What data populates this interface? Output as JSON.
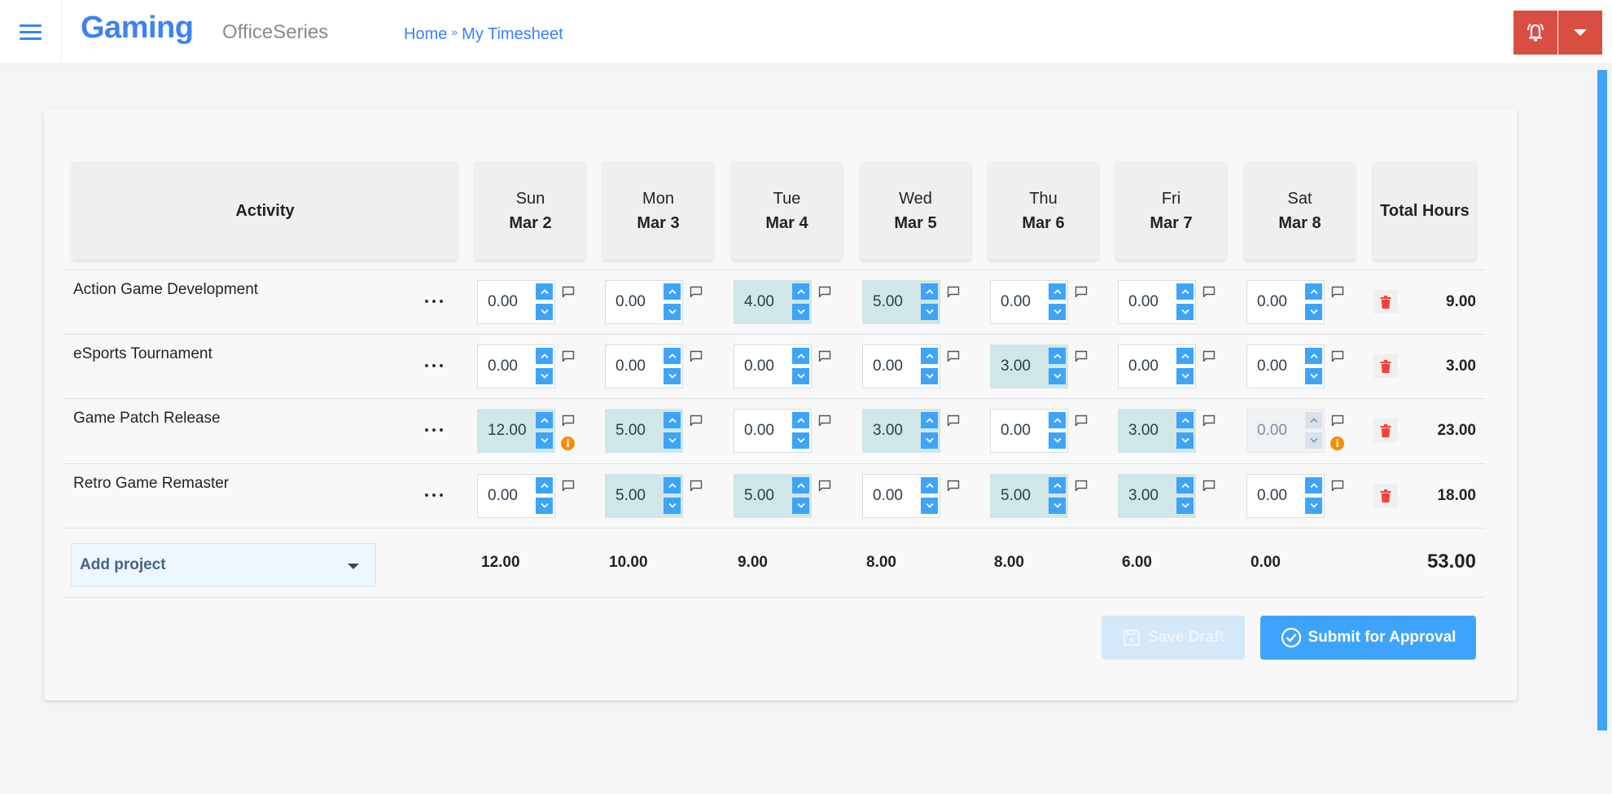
{
  "header": {
    "brand": "Gaming",
    "subbrand": "OfficeSeries",
    "breadcrumb": [
      {
        "label": "Home"
      },
      {
        "label": "My Timesheet"
      }
    ],
    "breadcrumb_separator": "»",
    "icons": {
      "menu": "hamburger-icon",
      "notifications": "bell-ring-icon",
      "dropdown": "caret-down-icon"
    },
    "accent_color": "#3b82f6",
    "action_color": "#d84f42"
  },
  "timesheet": {
    "columns": {
      "activity": "Activity",
      "total": "Total Hours",
      "days": [
        {
          "day": "Sun",
          "date": "Mar 2"
        },
        {
          "day": "Mon",
          "date": "Mar 3"
        },
        {
          "day": "Tue",
          "date": "Mar 4"
        },
        {
          "day": "Wed",
          "date": "Mar 5"
        },
        {
          "day": "Thu",
          "date": "Mar 6"
        },
        {
          "day": "Fri",
          "date": "Mar 7"
        },
        {
          "day": "Sat",
          "date": "Mar 8"
        }
      ]
    },
    "rows": [
      {
        "activity": "Action Game Development",
        "hours": [
          "0.00",
          "0.00",
          "4.00",
          "5.00",
          "0.00",
          "0.00",
          "0.00"
        ],
        "info": [
          false,
          false,
          false,
          false,
          false,
          false,
          false
        ],
        "disabled": [
          false,
          false,
          false,
          false,
          false,
          false,
          false
        ],
        "total": "9.00"
      },
      {
        "activity": "eSports Tournament",
        "hours": [
          "0.00",
          "0.00",
          "0.00",
          "0.00",
          "3.00",
          "0.00",
          "0.00"
        ],
        "info": [
          false,
          false,
          false,
          false,
          false,
          false,
          false
        ],
        "disabled": [
          false,
          false,
          false,
          false,
          false,
          false,
          false
        ],
        "total": "3.00"
      },
      {
        "activity": "Game Patch Release",
        "hours": [
          "12.00",
          "5.00",
          "0.00",
          "3.00",
          "0.00",
          "3.00",
          "0.00"
        ],
        "info": [
          true,
          false,
          false,
          false,
          false,
          false,
          true
        ],
        "disabled": [
          false,
          false,
          false,
          false,
          false,
          false,
          true
        ],
        "total": "23.00"
      },
      {
        "activity": "Retro Game Remaster",
        "hours": [
          "0.00",
          "5.00",
          "5.00",
          "0.00",
          "5.00",
          "3.00",
          "0.00"
        ],
        "info": [
          false,
          false,
          false,
          false,
          false,
          false,
          false
        ],
        "disabled": [
          false,
          false,
          false,
          false,
          false,
          false,
          false
        ],
        "total": "18.00"
      }
    ],
    "info_badge_glyph": "i",
    "add_project": {
      "label": "Add project"
    },
    "day_totals": [
      "12.00",
      "10.00",
      "9.00",
      "8.00",
      "8.00",
      "6.00",
      "0.00"
    ],
    "grand_total": "53.00",
    "filled_cell_color": "#d1e6e6",
    "info_color": "#fb8c00",
    "delete_color": "#f44336"
  },
  "actions": {
    "save_draft": {
      "label": "Save Draft",
      "icon": "floppy-disk-icon",
      "disabled": true
    },
    "submit": {
      "label": "Submit for Approval",
      "icon": "check-circle-icon"
    }
  }
}
